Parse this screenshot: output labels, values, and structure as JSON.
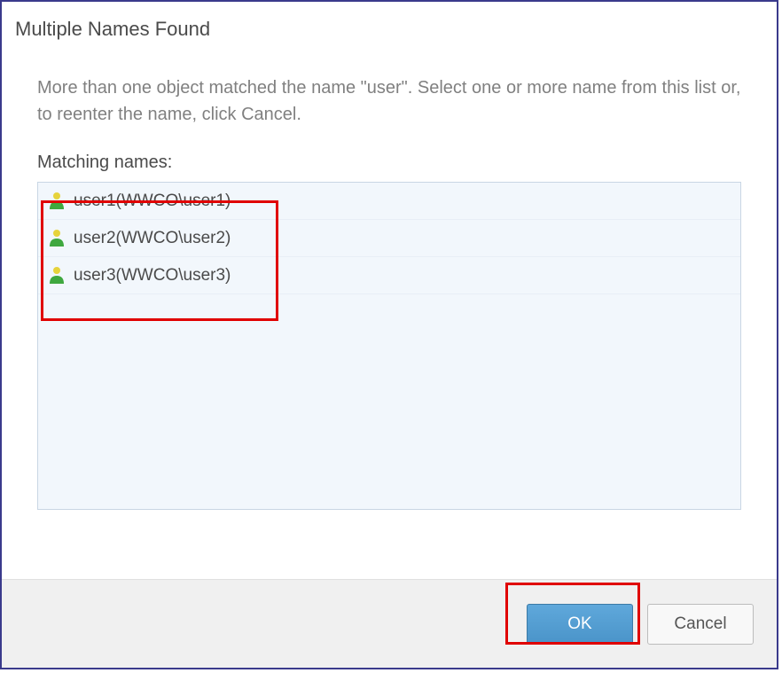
{
  "dialog": {
    "title": "Multiple Names Found",
    "description": "More than one object matched the name \"user\". Select one or more name from this list or, to reenter the name, click Cancel.",
    "list_label": "Matching names:",
    "items": [
      {
        "label": "user1(WWCO\\user1)"
      },
      {
        "label": "user2(WWCO\\user2)"
      },
      {
        "label": "user3(WWCO\\user3)"
      }
    ]
  },
  "buttons": {
    "ok": "OK",
    "cancel": "Cancel"
  }
}
